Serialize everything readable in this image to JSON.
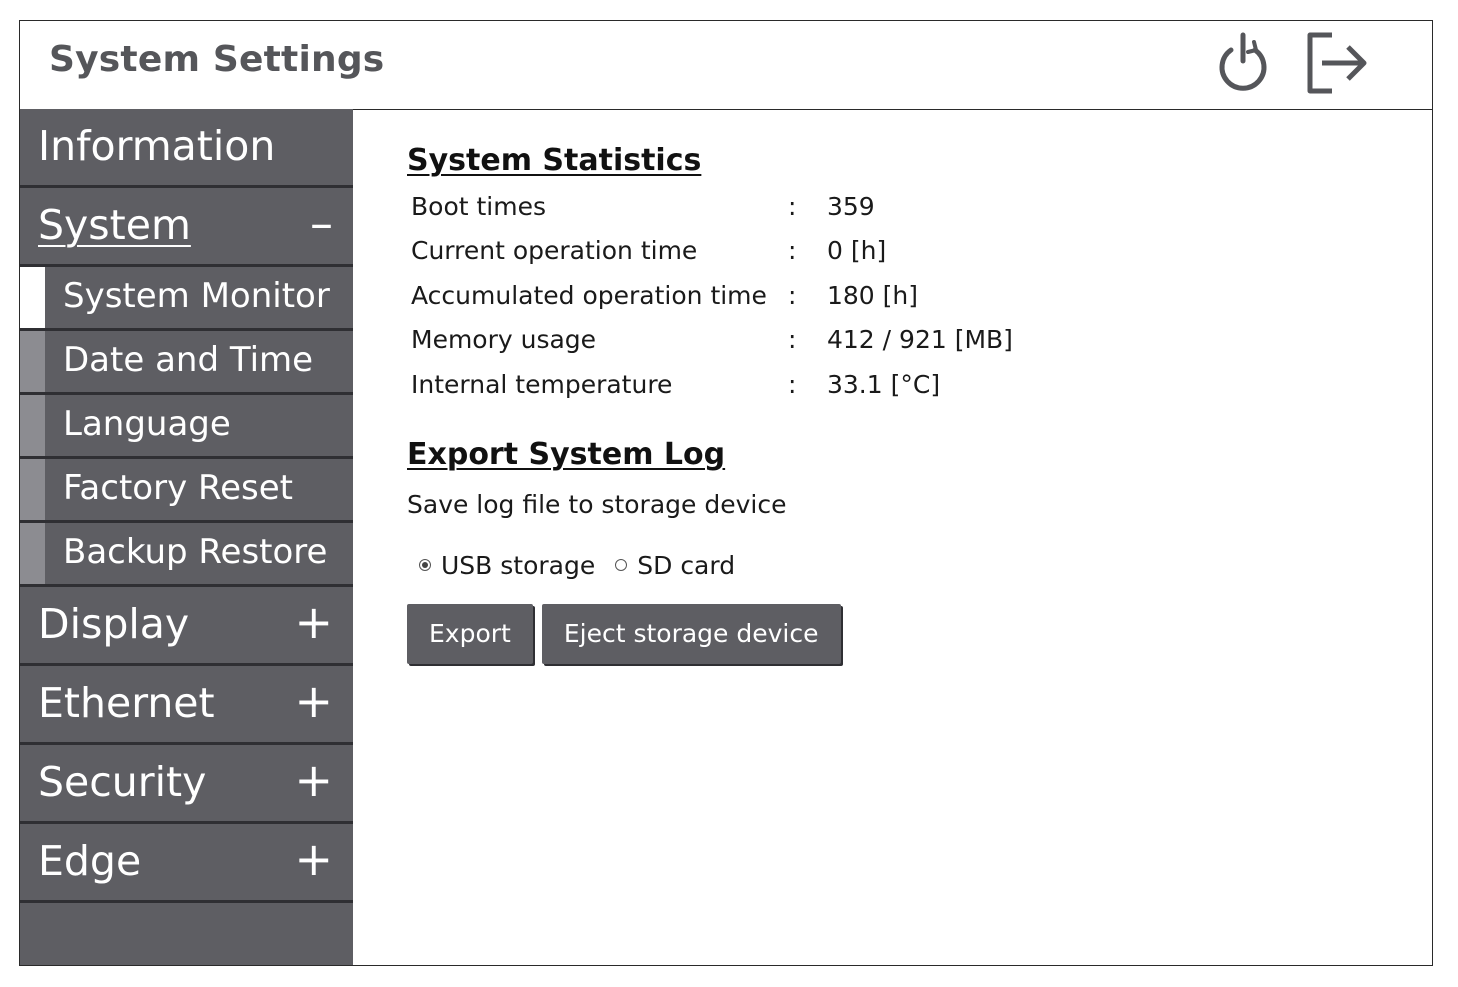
{
  "header": {
    "title": "System Settings",
    "icons": [
      "power-icon",
      "logout-icon"
    ]
  },
  "sidebar": {
    "items": [
      {
        "label": "Information",
        "sign": ""
      },
      {
        "label": "System",
        "sign": "–"
      },
      {
        "label": "Display",
        "sign": "+"
      },
      {
        "label": "Ethernet",
        "sign": "+"
      },
      {
        "label": "Security",
        "sign": "+"
      },
      {
        "label": "Edge",
        "sign": "+"
      }
    ],
    "system_sub_items": [
      {
        "label": "System Monitor"
      },
      {
        "label": "Date and Time"
      },
      {
        "label": "Language"
      },
      {
        "label": "Factory Reset"
      },
      {
        "label": "Backup Restore"
      }
    ]
  },
  "stats": {
    "title": "System Statistics",
    "separator": ":",
    "rows": [
      {
        "key": "Boot times",
        "value": "359"
      },
      {
        "key": "Current operation time",
        "value": "0 [h]"
      },
      {
        "key": "Accumulated operation time",
        "value": "180 [h]"
      },
      {
        "key": "Memory usage",
        "value": "412 / 921 [MB]"
      },
      {
        "key": "Internal temperature",
        "value": "33.1 [°C]"
      }
    ]
  },
  "export": {
    "title": "Export System Log",
    "description": "Save log file to storage device",
    "options": [
      {
        "label": "USB storage",
        "selected": true
      },
      {
        "label": "SD card",
        "selected": false
      }
    ],
    "export_button": "Export",
    "eject_button": "Eject storage device"
  },
  "colors": {
    "sidebar_bg": "#5e5e63",
    "sidebar_divider": "#2f2f33",
    "sub_indicator": "#8c8c91",
    "active_indicator": "#ffffff",
    "title_text": "#55565a"
  }
}
